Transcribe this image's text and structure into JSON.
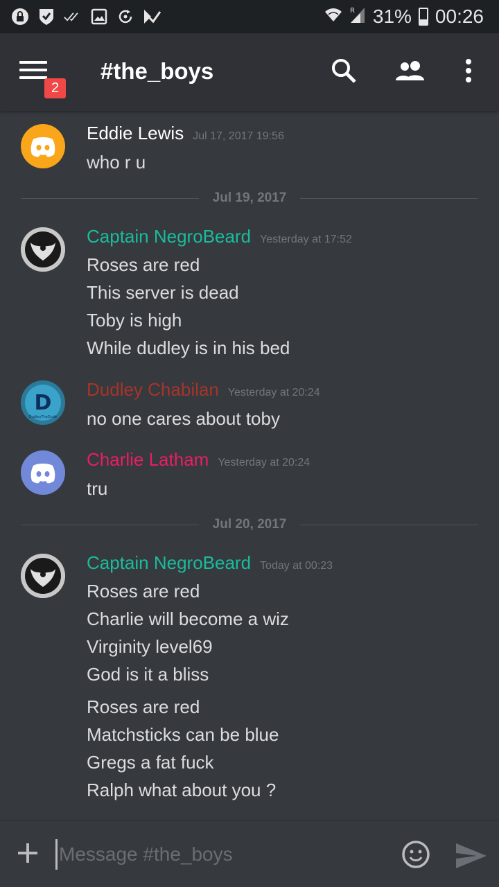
{
  "status_bar": {
    "battery": "31%",
    "battery_level": 0.31,
    "time": "00:26",
    "icons": [
      "vpn-lock-icon",
      "shield-check-icon",
      "double-check-icon",
      "image-icon",
      "sync-icon",
      "task-icon"
    ],
    "right_icons": [
      "wifi-icon",
      "cell-signal-icon",
      "battery-icon"
    ]
  },
  "header": {
    "channel": "#the_boys",
    "notification_count": "2",
    "icons": [
      "hamburger-menu-icon",
      "search-icon",
      "members-icon",
      "more-vert-icon"
    ]
  },
  "messages": [
    {
      "author": "Eddie Lewis",
      "author_color": "#ffffff",
      "timestamp": "Jul 17, 2017 19:56",
      "avatar": "discord-logo-orange",
      "avatar_color": "#faa61a",
      "lines": [
        "who r u"
      ]
    },
    {
      "divider": "Jul 19, 2017"
    },
    {
      "author": "Captain NegroBeard",
      "author_color": "#1abc9c",
      "timestamp": "Yesterday at 17:52",
      "avatar": "phoenix-avatar",
      "lines": [
        "Roses are red",
        "This server is dead",
        "Toby is high",
        "While dudley is in his bed"
      ]
    },
    {
      "author": "Dudley Chabilan",
      "author_color": "#a5352b",
      "timestamp": "Yesterday at 20:24",
      "avatar": "d-logo-avatar",
      "avatar_caption": "DudleyTheDude",
      "lines": [
        "no one cares about toby"
      ]
    },
    {
      "author": "Charlie Latham",
      "author_color": "#e91e63",
      "timestamp": "Yesterday at 20:24",
      "avatar": "discord-logo-blurple",
      "avatar_color": "#7289da",
      "lines": [
        "tru"
      ]
    },
    {
      "divider": "Jul 20, 2017"
    },
    {
      "author": "Captain NegroBeard",
      "author_color": "#1abc9c",
      "timestamp": "Today at 00:23",
      "avatar": "phoenix-avatar",
      "lines": [
        "Roses are red",
        "Charlie will become a wiz",
        "Virginity level69",
        "God is it a bliss"
      ],
      "lines2": [
        "Roses are red",
        "Matchsticks can be blue",
        "Gregs a fat fuck",
        "Ralph what about you ?"
      ]
    }
  ],
  "input": {
    "placeholder": "Message #the_boys",
    "value": ""
  },
  "colors": {
    "background": "#36393e",
    "header": "#2f3136",
    "status_bar": "#1e2124",
    "badge": "#f04747",
    "muted": "#72767d"
  }
}
